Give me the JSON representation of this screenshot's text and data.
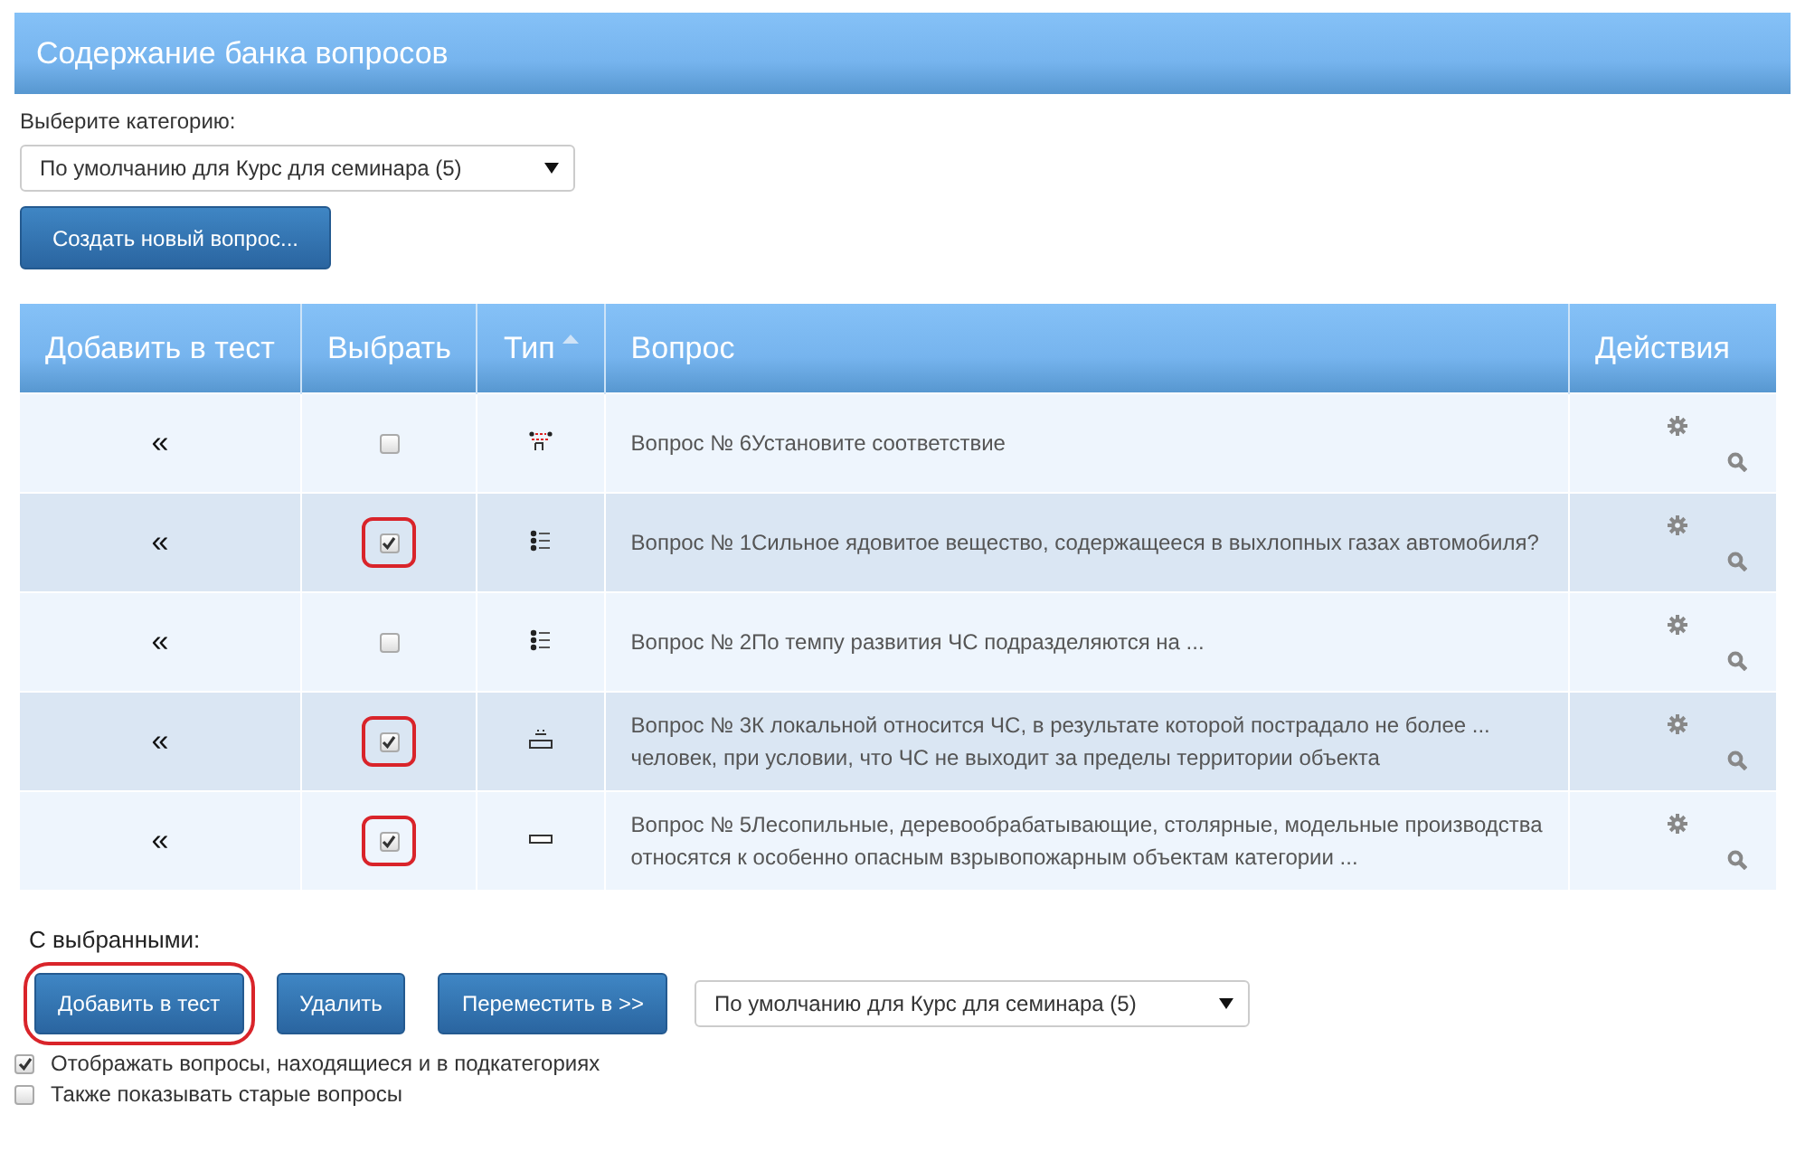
{
  "header": {
    "title": "Содержание банка вопросов"
  },
  "category": {
    "label": "Выберите категорию:",
    "value": "По умолчанию для Курс для семинара (5)"
  },
  "create_button": "Создать новый вопрос...",
  "table": {
    "columns": [
      {
        "label": "Добавить в тест",
        "sorted": false
      },
      {
        "label": "Выбрать",
        "sorted": false
      },
      {
        "label": "Тип",
        "sorted": true
      },
      {
        "label": "Вопрос",
        "sorted": false
      },
      {
        "label": "Действия",
        "sorted": false
      }
    ],
    "rows": [
      {
        "add": "«",
        "checked": false,
        "highlighted": false,
        "kind": "match",
        "question": "Вопрос № 6Установите соответствие"
      },
      {
        "add": "«",
        "checked": true,
        "highlighted": true,
        "kind": "multichoice",
        "question": "Вопрос № 1Сильное ядовитое вещество, содержащееся в выхлопных газах автомобиля?"
      },
      {
        "add": "«",
        "checked": false,
        "highlighted": false,
        "kind": "multichoice",
        "question": "Вопрос № 2По темпу развития ЧС подразделяются на ..."
      },
      {
        "add": "«",
        "checked": true,
        "highlighted": true,
        "kind": "numerical",
        "question": "Вопрос № 3К локальной относится ЧС, в результате которой пострадало не более ... человек, при условии, что ЧС не выходит за пределы территории объекта"
      },
      {
        "add": "«",
        "checked": true,
        "highlighted": true,
        "kind": "shortanswer",
        "question": "Вопрос № 5Лесопильные, деревообрабатывающие, столярные, модельные производства относятся к особенно опасным взрывопожарным объектам категории ..."
      }
    ]
  },
  "with_selected": {
    "label": "С выбранными:",
    "buttons": [
      {
        "label": "Добавить в тест",
        "highlighted": true
      },
      {
        "label": "Удалить",
        "highlighted": false
      },
      {
        "label": "Переместить в >>",
        "highlighted": false
      }
    ],
    "target": "По умолчанию для Курс для семинара (5)"
  },
  "options": [
    {
      "label": "Отображать вопросы, находящиеся и в подкатегориях",
      "checked": true
    },
    {
      "label": "Также показывать старые вопросы",
      "checked": false
    }
  ]
}
